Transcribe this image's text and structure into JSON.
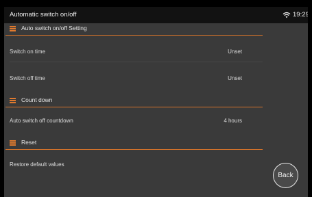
{
  "status_bar": {
    "title": "Automatic switch on/off",
    "time": "19:29",
    "wifi_icon": "wifi-icon"
  },
  "colors": {
    "accent": "#d8742a",
    "background": "#3a3a3a",
    "status_bar": "#121212"
  },
  "sections": [
    {
      "header": "Auto switch on/off Setting",
      "header_icon": "menu-icon",
      "rows": [
        {
          "label": "Switch on time",
          "value": "Unset"
        },
        {
          "label": "Switch off time",
          "value": "Unset"
        }
      ]
    },
    {
      "header": "Count down",
      "header_icon": "menu-icon",
      "rows": [
        {
          "label": "Auto switch off countdown",
          "value": "4 hours"
        }
      ]
    },
    {
      "header": "Reset",
      "header_icon": "menu-icon",
      "rows": [
        {
          "label": "Restore default values",
          "value": ""
        }
      ]
    }
  ],
  "back_button": {
    "label": "Back"
  }
}
